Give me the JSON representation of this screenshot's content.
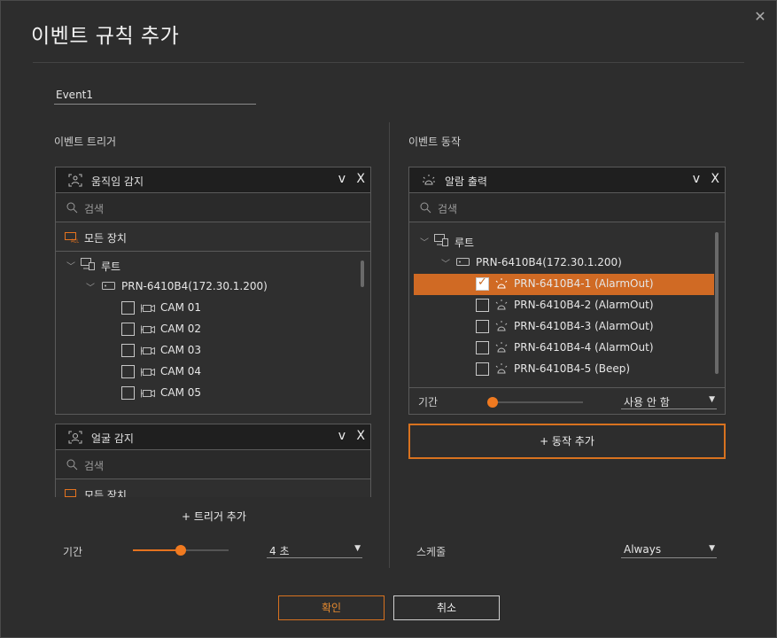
{
  "dialog": {
    "title": "이벤트 규칙 추가",
    "name_value": "Event1",
    "confirm_label": "확인",
    "cancel_label": "취소"
  },
  "trigger": {
    "section_label": "이벤트 트리거",
    "panel1": {
      "label": "움직임 감지",
      "chevron": "v",
      "remove": "X",
      "search_placeholder": "검색",
      "all_devices": "모든 장치",
      "root": "루트",
      "device": "PRN-6410B4(172.30.1.200)",
      "cameras": [
        "CAM 01",
        "CAM 02",
        "CAM 03",
        "CAM 04",
        "CAM 05"
      ]
    },
    "panel2": {
      "label": "얼굴 감지",
      "chevron": "v",
      "remove": "X",
      "search_placeholder": "검색",
      "all_devices": "모든 장치"
    },
    "add_label": "+ 트리거 추가",
    "duration_label": "기간",
    "duration_value": "4 초",
    "duration_level": 0.5
  },
  "action": {
    "section_label": "이벤트 동작",
    "panel": {
      "label": "알람 출력",
      "chevron": "v",
      "remove": "X",
      "search_placeholder": "검색",
      "root": "루트",
      "device": "PRN-6410B4(172.30.1.200)",
      "outputs": [
        {
          "label": "PRN-6410B4-1 (AlarmOut)",
          "checked": true
        },
        {
          "label": "PRN-6410B4-2 (AlarmOut)",
          "checked": false
        },
        {
          "label": "PRN-6410B4-3 (AlarmOut)",
          "checked": false
        },
        {
          "label": "PRN-6410B4-4 (AlarmOut)",
          "checked": false
        },
        {
          "label": "PRN-6410B4-5 (Beep)",
          "checked": false
        }
      ],
      "duration_label": "기간",
      "duration_value": "사용 안 함",
      "duration_level": 0.0
    },
    "add_label": "+ 동작 추가",
    "schedule_label": "스케줄",
    "schedule_value": "Always"
  },
  "colors": {
    "accent": "#e5731f",
    "selected_row": "#d06a24",
    "background": "#2d2d2d"
  },
  "icons": {
    "close": "close-icon",
    "motion": "motion-detect-icon",
    "face": "face-detect-icon",
    "alarm": "alarm-output-icon",
    "search": "search-icon",
    "all_devices": "all-devices-icon",
    "root": "root-site-icon",
    "recorder": "recorder-icon",
    "camera": "camera-icon"
  }
}
